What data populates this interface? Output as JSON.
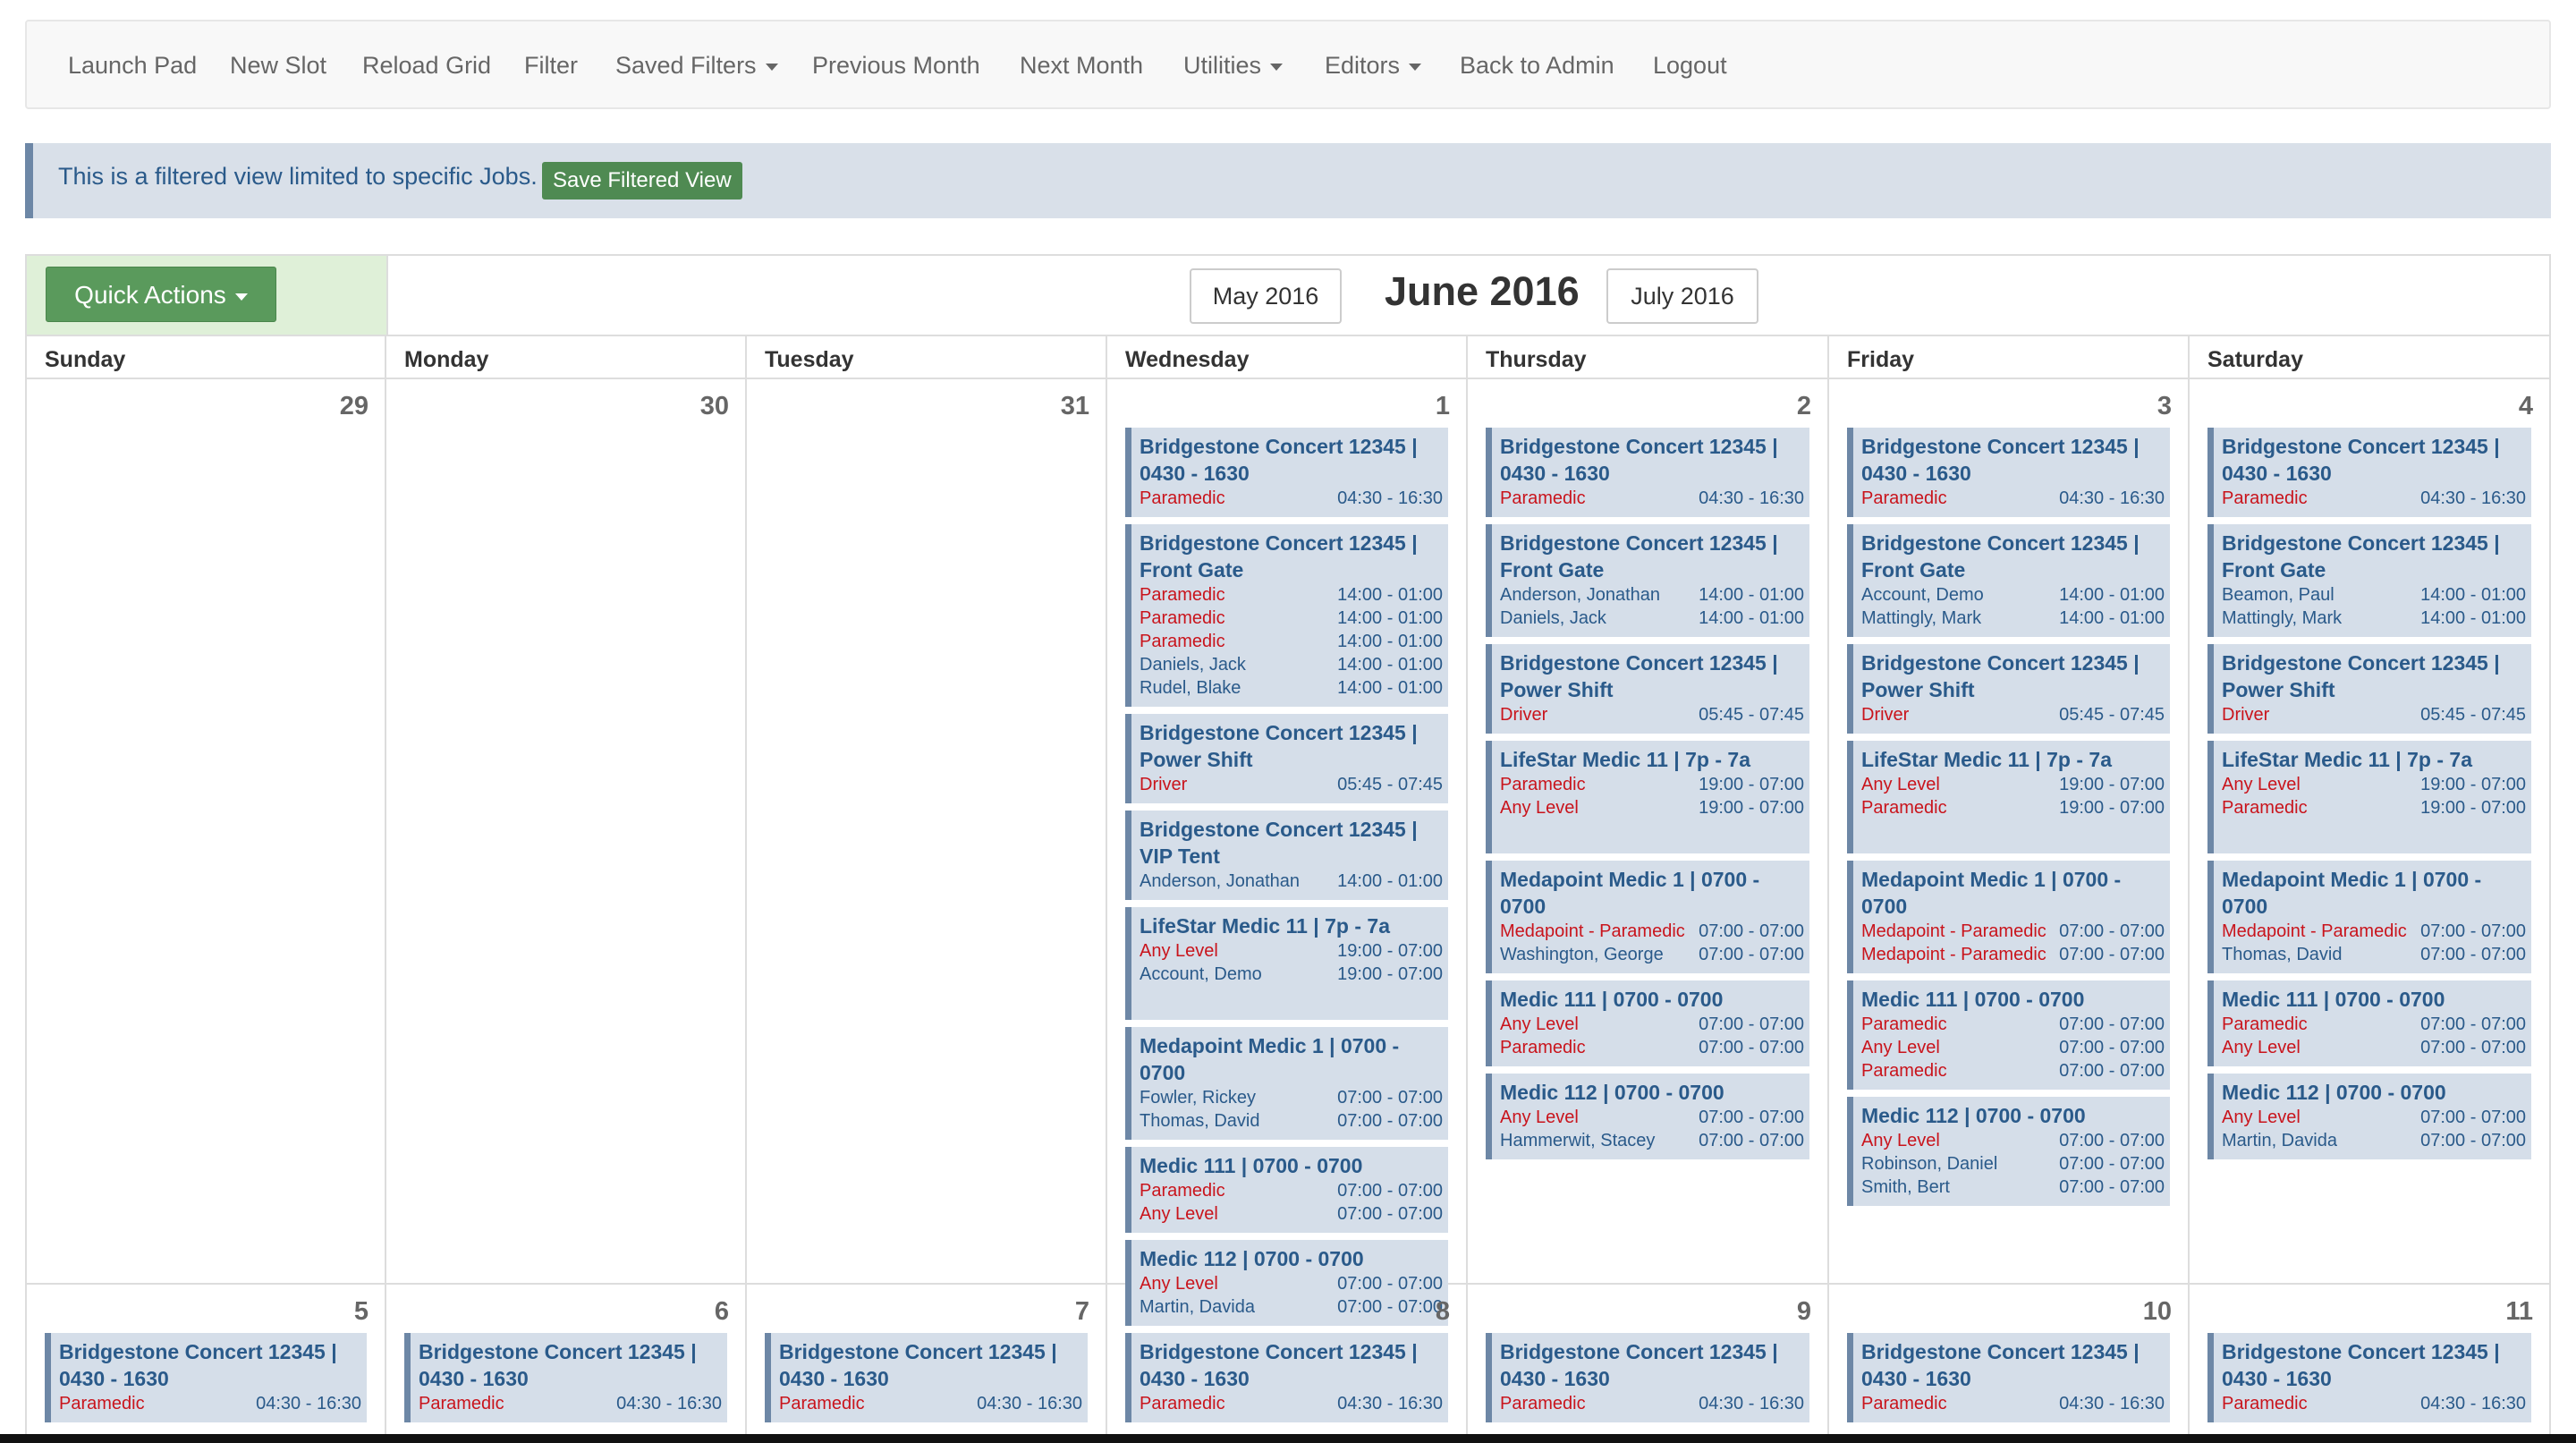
{
  "nav": {
    "launch_pad": "Launch Pad",
    "new_slot": "New Slot",
    "reload_grid": "Reload Grid",
    "filter": "Filter",
    "saved_filters": "Saved Filters",
    "previous_month": "Previous Month",
    "next_month": "Next Month",
    "utilities": "Utilities",
    "editors": "Editors",
    "back_to_admin": "Back to Admin",
    "logout": "Logout"
  },
  "alert": {
    "text": "This is a filtered view limited to specific Jobs.",
    "save_button": "Save Filtered View"
  },
  "calendar": {
    "quick_actions": "Quick Actions",
    "prev_month": "May 2016",
    "title": "June 2016",
    "next_month": "July 2016",
    "weekdays": [
      "Sunday",
      "Monday",
      "Tuesday",
      "Wednesday",
      "Thursday",
      "Friday",
      "Saturday"
    ],
    "weeks": [
      [
        {
          "day": "29",
          "events": []
        },
        {
          "day": "30",
          "events": []
        },
        {
          "day": "31",
          "events": []
        },
        {
          "day": "1",
          "events": [
            {
              "title": "Bridgestone Concert 12345 | 0430 - 1630",
              "rows": [
                {
                  "who": "Paramedic",
                  "open": true,
                  "time": "04:30 - 16:30"
                }
              ]
            },
            {
              "title": "Bridgestone Concert 12345 | Front Gate",
              "rows": [
                {
                  "who": "Paramedic",
                  "open": true,
                  "time": "14:00 - 01:00"
                },
                {
                  "who": "Paramedic",
                  "open": true,
                  "time": "14:00 - 01:00"
                },
                {
                  "who": "Paramedic",
                  "open": true,
                  "time": "14:00 - 01:00"
                },
                {
                  "who": "Daniels, Jack",
                  "open": false,
                  "time": "14:00 - 01:00"
                },
                {
                  "who": "Rudel, Blake",
                  "open": false,
                  "time": "14:00 - 01:00"
                }
              ]
            },
            {
              "title": "Bridgestone Concert 12345 | Power Shift",
              "rows": [
                {
                  "who": "Driver",
                  "open": true,
                  "time": "05:45 - 07:45"
                }
              ]
            },
            {
              "title": "Bridgestone Concert 12345 | VIP Tent",
              "rows": [
                {
                  "who": "Anderson, Jonathan",
                  "open": false,
                  "time": "14:00 - 01:00"
                }
              ]
            },
            {
              "title": "LifeStar Medic 11 | 7p - 7a",
              "rows": [
                {
                  "who": "Any Level",
                  "open": true,
                  "time": "19:00 - 07:00"
                },
                {
                  "who": "Account, Demo",
                  "open": false,
                  "time": "19:00 - 07:00"
                }
              ]
            },
            {
              "title": "Medapoint Medic 1 | 0700 - 0700",
              "rows": [
                {
                  "who": "Fowler, Rickey",
                  "open": false,
                  "time": "07:00 - 07:00"
                },
                {
                  "who": "Thomas, David",
                  "open": false,
                  "time": "07:00 - 07:00"
                }
              ]
            },
            {
              "title": "Medic 111 | 0700 - 0700",
              "rows": [
                {
                  "who": "Paramedic",
                  "open": true,
                  "time": "07:00 - 07:00"
                },
                {
                  "who": "Any Level",
                  "open": true,
                  "time": "07:00 - 07:00"
                }
              ]
            },
            {
              "title": "Medic 112 | 0700 - 0700",
              "rows": [
                {
                  "who": "Any Level",
                  "open": true,
                  "time": "07:00 - 07:00"
                },
                {
                  "who": "Martin, Davida",
                  "open": false,
                  "time": "07:00 - 07:00"
                }
              ]
            }
          ]
        },
        {
          "day": "2",
          "events": [
            {
              "title": "Bridgestone Concert 12345 | 0430 - 1630",
              "rows": [
                {
                  "who": "Paramedic",
                  "open": true,
                  "time": "04:30 - 16:30"
                }
              ]
            },
            {
              "title": "Bridgestone Concert 12345 | Front Gate",
              "rows": [
                {
                  "who": "Anderson, Jonathan",
                  "open": false,
                  "time": "14:00 - 01:00"
                },
                {
                  "who": "Daniels, Jack",
                  "open": false,
                  "time": "14:00 - 01:00"
                }
              ]
            },
            {
              "title": "Bridgestone Concert 12345 | Power Shift",
              "rows": [
                {
                  "who": "Driver",
                  "open": true,
                  "time": "05:45 - 07:45"
                }
              ]
            },
            {
              "title": "LifeStar Medic 11 | 7p - 7a",
              "rows": [
                {
                  "who": "Paramedic",
                  "open": true,
                  "time": "19:00 - 07:00"
                },
                {
                  "who": "Any Level",
                  "open": true,
                  "time": "19:00 - 07:00"
                }
              ]
            },
            {
              "title": "Medapoint Medic 1 | 0700 - 0700",
              "rows": [
                {
                  "who": "Medapoint - Paramedic",
                  "open": true,
                  "time": "07:00 - 07:00"
                },
                {
                  "who": "Washington, George",
                  "open": false,
                  "time": "07:00 - 07:00"
                }
              ]
            },
            {
              "title": "Medic 111 | 0700 - 0700",
              "rows": [
                {
                  "who": "Any Level",
                  "open": true,
                  "time": "07:00 - 07:00"
                },
                {
                  "who": "Paramedic",
                  "open": true,
                  "time": "07:00 - 07:00"
                }
              ]
            },
            {
              "title": "Medic 112 | 0700 - 0700",
              "rows": [
                {
                  "who": "Any Level",
                  "open": true,
                  "time": "07:00 - 07:00"
                },
                {
                  "who": "Hammerwit, Stacey",
                  "open": false,
                  "time": "07:00 - 07:00"
                }
              ]
            }
          ]
        },
        {
          "day": "3",
          "events": [
            {
              "title": "Bridgestone Concert 12345 | 0430 - 1630",
              "rows": [
                {
                  "who": "Paramedic",
                  "open": true,
                  "time": "04:30 - 16:30"
                }
              ]
            },
            {
              "title": "Bridgestone Concert 12345 | Front Gate",
              "rows": [
                {
                  "who": "Account, Demo",
                  "open": false,
                  "time": "14:00 - 01:00"
                },
                {
                  "who": "Mattingly, Mark",
                  "open": false,
                  "time": "14:00 - 01:00"
                }
              ]
            },
            {
              "title": "Bridgestone Concert 12345 | Power Shift",
              "rows": [
                {
                  "who": "Driver",
                  "open": true,
                  "time": "05:45 - 07:45"
                }
              ]
            },
            {
              "title": "LifeStar Medic 11 | 7p - 7a",
              "rows": [
                {
                  "who": "Any Level",
                  "open": true,
                  "time": "19:00 - 07:00"
                },
                {
                  "who": "Paramedic",
                  "open": true,
                  "time": "19:00 - 07:00"
                }
              ]
            },
            {
              "title": "Medapoint Medic 1 | 0700 - 0700",
              "rows": [
                {
                  "who": "Medapoint - Paramedic",
                  "open": true,
                  "time": "07:00 - 07:00"
                },
                {
                  "who": "Medapoint - Paramedic",
                  "open": true,
                  "time": "07:00 - 07:00"
                }
              ]
            },
            {
              "title": "Medic 111 | 0700 - 0700",
              "rows": [
                {
                  "who": "Paramedic",
                  "open": true,
                  "time": "07:00 - 07:00"
                },
                {
                  "who": "Any Level",
                  "open": true,
                  "time": "07:00 - 07:00"
                },
                {
                  "who": "Paramedic",
                  "open": true,
                  "time": "07:00 - 07:00"
                }
              ]
            },
            {
              "title": "Medic 112 | 0700 - 0700",
              "rows": [
                {
                  "who": "Any Level",
                  "open": true,
                  "time": "07:00 - 07:00"
                },
                {
                  "who": "Robinson, Daniel",
                  "open": false,
                  "time": "07:00 - 07:00"
                },
                {
                  "who": "Smith, Bert",
                  "open": false,
                  "time": "07:00 - 07:00"
                }
              ]
            }
          ]
        },
        {
          "day": "4",
          "events": [
            {
              "title": "Bridgestone Concert 12345 | 0430 - 1630",
              "rows": [
                {
                  "who": "Paramedic",
                  "open": true,
                  "time": "04:30 - 16:30"
                }
              ]
            },
            {
              "title": "Bridgestone Concert 12345 | Front Gate",
              "rows": [
                {
                  "who": "Beamon, Paul",
                  "open": false,
                  "time": "14:00 - 01:00"
                },
                {
                  "who": "Mattingly, Mark",
                  "open": false,
                  "time": "14:00 - 01:00"
                }
              ]
            },
            {
              "title": "Bridgestone Concert 12345 | Power Shift",
              "rows": [
                {
                  "who": "Driver",
                  "open": true,
                  "time": "05:45 - 07:45"
                }
              ]
            },
            {
              "title": "LifeStar Medic 11 | 7p - 7a",
              "rows": [
                {
                  "who": "Any Level",
                  "open": true,
                  "time": "19:00 - 07:00"
                },
                {
                  "who": "Paramedic",
                  "open": true,
                  "time": "19:00 - 07:00"
                }
              ]
            },
            {
              "title": "Medapoint Medic 1 | 0700 - 0700",
              "rows": [
                {
                  "who": "Medapoint - Paramedic",
                  "open": true,
                  "time": "07:00 - 07:00"
                },
                {
                  "who": "Thomas, David",
                  "open": false,
                  "time": "07:00 - 07:00"
                }
              ]
            },
            {
              "title": "Medic 111 | 0700 - 0700",
              "rows": [
                {
                  "who": "Paramedic",
                  "open": true,
                  "time": "07:00 - 07:00"
                },
                {
                  "who": "Any Level",
                  "open": true,
                  "time": "07:00 - 07:00"
                }
              ]
            },
            {
              "title": "Medic 112 | 0700 - 0700",
              "rows": [
                {
                  "who": "Any Level",
                  "open": true,
                  "time": "07:00 - 07:00"
                },
                {
                  "who": "Martin, Davida",
                  "open": false,
                  "time": "07:00 - 07:00"
                }
              ]
            }
          ]
        }
      ],
      [
        {
          "day": "5",
          "events": [
            {
              "title": "Bridgestone Concert 12345 | 0430 - 1630",
              "rows": [
                {
                  "who": "Paramedic",
                  "open": true,
                  "time": "04:30 - 16:30"
                }
              ]
            }
          ]
        },
        {
          "day": "6",
          "events": [
            {
              "title": "Bridgestone Concert 12345 | 0430 - 1630",
              "rows": [
                {
                  "who": "Paramedic",
                  "open": true,
                  "time": "04:30 - 16:30"
                }
              ]
            }
          ]
        },
        {
          "day": "7",
          "events": [
            {
              "title": "Bridgestone Concert 12345 | 0430 - 1630",
              "rows": [
                {
                  "who": "Paramedic",
                  "open": true,
                  "time": "04:30 - 16:30"
                }
              ]
            }
          ]
        },
        {
          "day": "8",
          "events": [
            {
              "title": "Bridgestone Concert 12345 | 0430 - 1630",
              "rows": [
                {
                  "who": "Paramedic",
                  "open": true,
                  "time": "04:30 - 16:30"
                }
              ]
            }
          ]
        },
        {
          "day": "9",
          "events": [
            {
              "title": "Bridgestone Concert 12345 | 0430 - 1630",
              "rows": [
                {
                  "who": "Paramedic",
                  "open": true,
                  "time": "04:30 - 16:30"
                }
              ]
            }
          ]
        },
        {
          "day": "10",
          "events": [
            {
              "title": "Bridgestone Concert 12345 | 0430 - 1630",
              "rows": [
                {
                  "who": "Paramedic",
                  "open": true,
                  "time": "04:30 - 16:30"
                }
              ]
            }
          ]
        },
        {
          "day": "11",
          "events": [
            {
              "title": "Bridgestone Concert 12345 | 0430 - 1630",
              "rows": [
                {
                  "who": "Paramedic",
                  "open": true,
                  "time": "04:30 - 16:30"
                }
              ]
            }
          ]
        }
      ]
    ]
  }
}
